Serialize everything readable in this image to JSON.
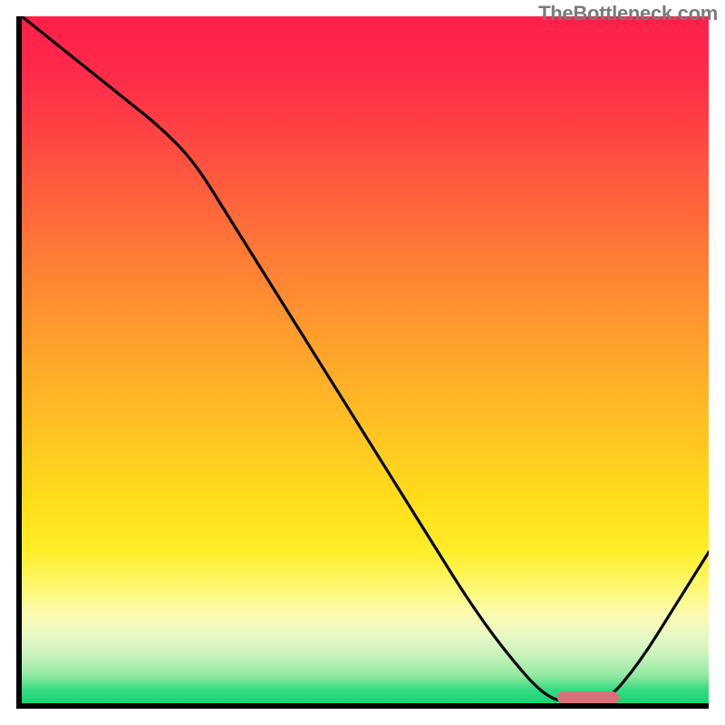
{
  "watermark": "TheBottleneck.com",
  "colors": {
    "axis": "#000000",
    "curve": "#000000",
    "marker": "#d6717a",
    "gradient_top": "#ff1f4a",
    "gradient_bottom": "#18d574"
  },
  "chart_data": {
    "type": "line",
    "title": "",
    "xlabel": "",
    "ylabel": "",
    "xlim": [
      0,
      100
    ],
    "ylim": [
      0,
      100
    ],
    "grid": false,
    "legend": false,
    "series": [
      {
        "name": "bottleneck-curve",
        "x": [
          0,
          5,
          10,
          15,
          20,
          25,
          30,
          35,
          40,
          45,
          50,
          55,
          60,
          65,
          70,
          76,
          80,
          85,
          90,
          95,
          100
        ],
        "values": [
          100,
          96,
          92,
          88,
          84,
          79,
          71,
          63,
          55,
          47,
          39,
          31,
          23,
          15,
          8,
          1,
          0,
          0,
          6,
          14,
          22
        ]
      }
    ],
    "annotations": [
      {
        "name": "optimal-marker",
        "type": "pill",
        "x_start": 78,
        "x_end": 87,
        "y": 0
      }
    ]
  }
}
